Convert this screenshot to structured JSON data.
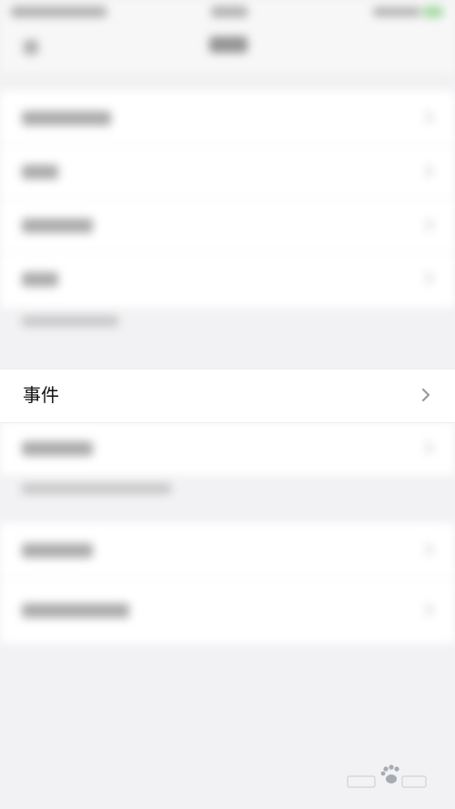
{
  "event_row": {
    "label": "事件",
    "icon": "chevron-right-icon"
  },
  "watermark": {
    "logo": "baidu-jingyan-logo",
    "text": "Bai经验"
  }
}
